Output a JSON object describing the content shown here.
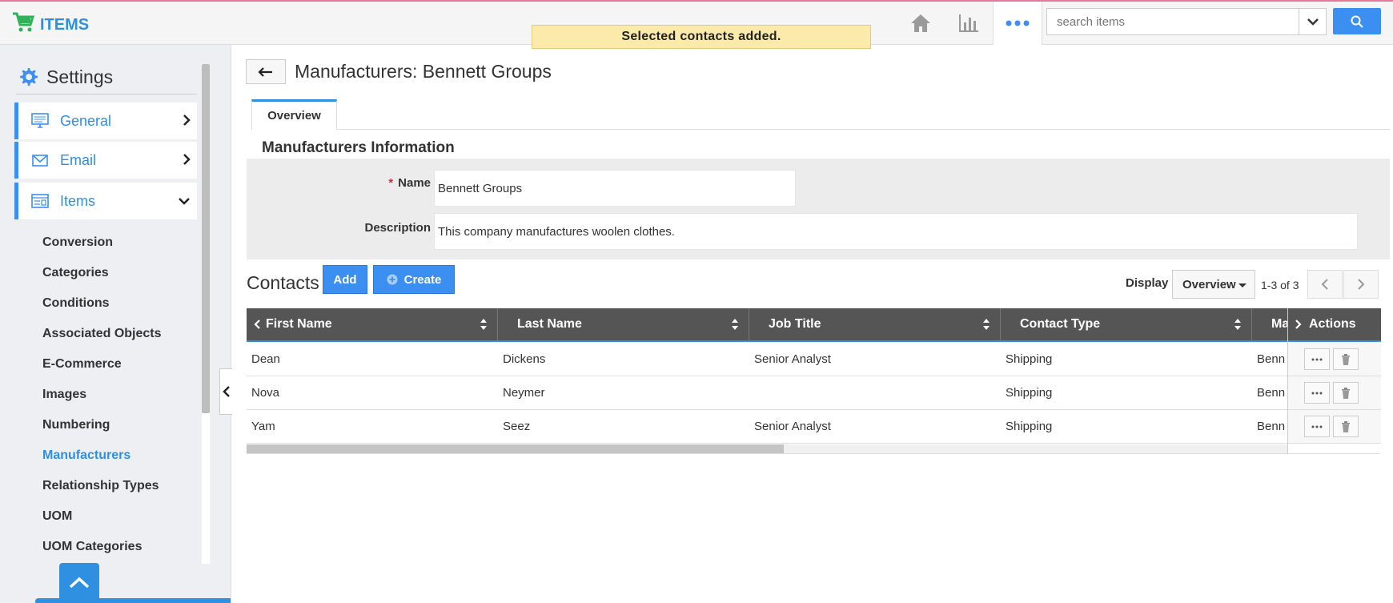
{
  "app": {
    "title": "ITEMS"
  },
  "toast": "Selected contacts added.",
  "search": {
    "placeholder": "search items"
  },
  "sidebar": {
    "heading": "Settings",
    "cards": [
      {
        "label": "General"
      },
      {
        "label": "Email"
      },
      {
        "label": "Items"
      }
    ],
    "sub_items": [
      {
        "label": "Conversion"
      },
      {
        "label": "Categories"
      },
      {
        "label": "Conditions"
      },
      {
        "label": "Associated Objects"
      },
      {
        "label": "E-Commerce"
      },
      {
        "label": "Images"
      },
      {
        "label": "Numbering"
      },
      {
        "label": "Manufacturers"
      },
      {
        "label": "Relationship Types"
      },
      {
        "label": "UOM"
      },
      {
        "label": "UOM Categories"
      }
    ]
  },
  "page": {
    "title": "Manufacturers: Bennett Groups",
    "tab": "Overview",
    "section_title": "Manufacturers Information",
    "fields": {
      "name_label": "Name",
      "name_value": "Bennett Groups",
      "description_label": "Description",
      "description_value": "This company manufactures woolen clothes."
    }
  },
  "contacts": {
    "title": "Contacts",
    "add_label": "Add",
    "create_label": "Create",
    "display_label": "Display",
    "display_value": "Overview",
    "page_count": "1-3 of 3",
    "columns": [
      "First Name",
      "Last Name",
      "Job Title",
      "Contact Type",
      "Ma"
    ],
    "actions_header": "Actions",
    "rows": [
      {
        "first": "Dean",
        "last": "Dickens",
        "job": "Senior Analyst",
        "type": "Shipping",
        "ma": "Benn"
      },
      {
        "first": "Nova",
        "last": "Neymer",
        "job": "",
        "type": "Shipping",
        "ma": "Benn"
      },
      {
        "first": "Yam",
        "last": "Seez",
        "job": "Senior Analyst",
        "type": "Shipping",
        "ma": "Benn"
      }
    ]
  },
  "colors": {
    "accent": "#3b8ff0",
    "header_bg": "#555555",
    "toast_bg": "#fbeaaa",
    "sidebar_bg": "#eeeff3"
  }
}
